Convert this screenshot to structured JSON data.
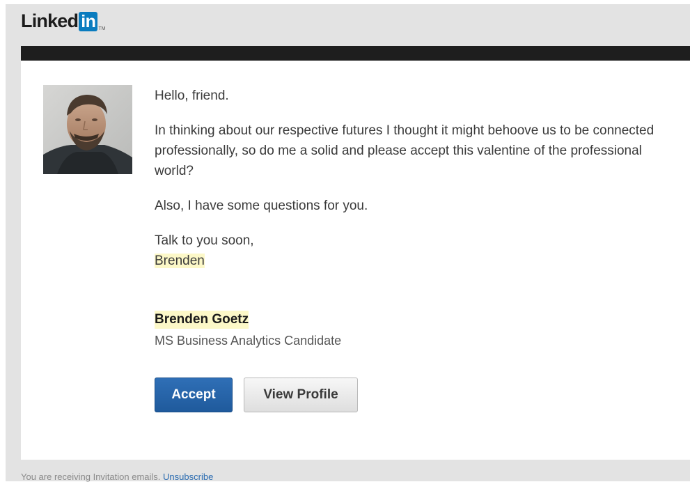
{
  "brand": {
    "logo_word": "Linked",
    "logo_box": "in",
    "logo_tm": "TM",
    "box_color": "#0a7cbf"
  },
  "message": {
    "greeting": "Hello, friend.",
    "body": "In thinking about our respective futures I thought it might behoove us to be connected professionally, so do me a solid and please accept this valentine of the professional world?",
    "questions": "Also, I have some questions for you.",
    "closing": "Talk to you soon,",
    "signature": "Brenden"
  },
  "sender": {
    "name": "Brenden Goetz",
    "title": "MS Business Analytics Candidate"
  },
  "actions": {
    "accept_label": "Accept",
    "view_profile_label": "View Profile"
  },
  "footer": {
    "text": "You are receiving Invitation emails.",
    "unsubscribe": "Unsubscribe"
  },
  "colors": {
    "accent": "#1f5a9c",
    "highlight": "#fcf8c8"
  }
}
